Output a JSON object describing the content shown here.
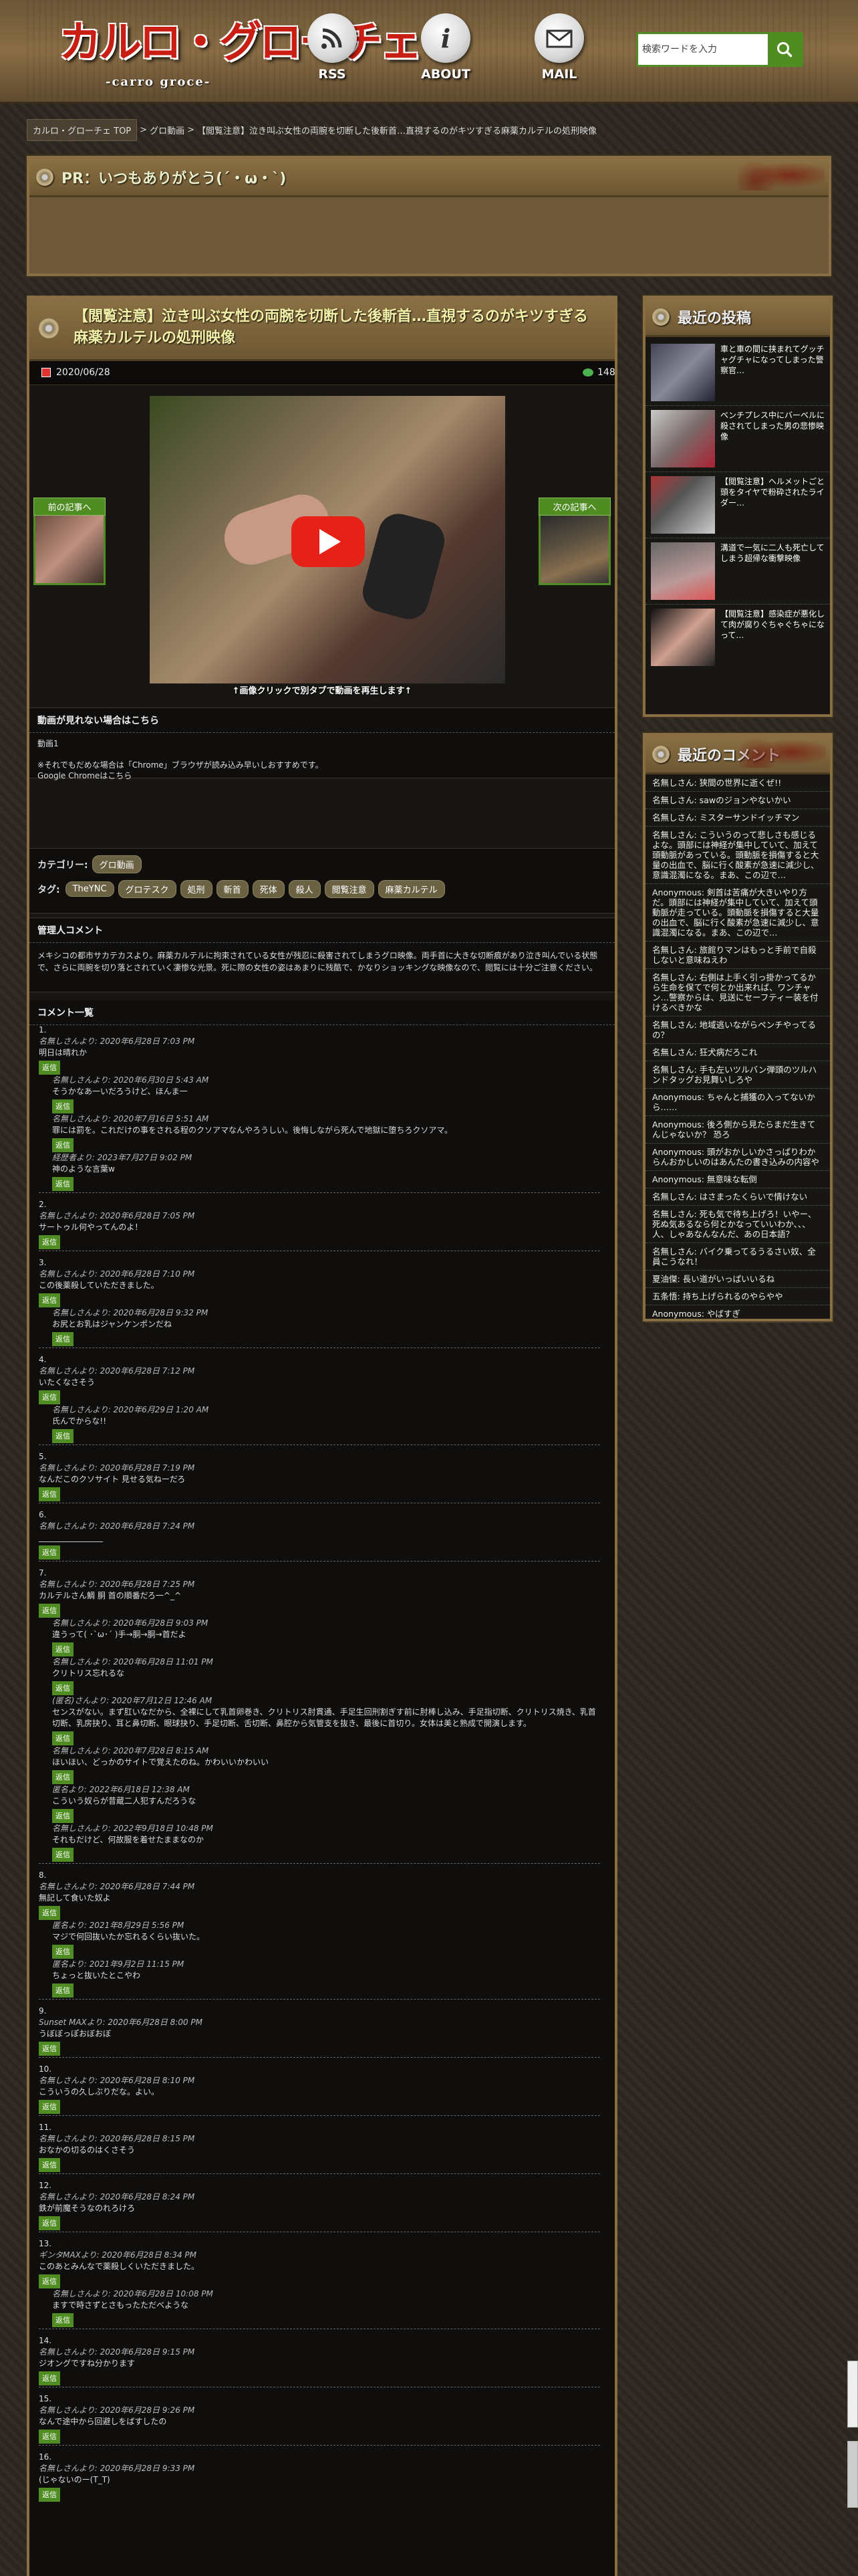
{
  "header": {
    "logo_main": "カルロ・グローチェ",
    "logo_sub": "-carro groce-",
    "nav": [
      {
        "label": "RSS",
        "icon": "rss-icon"
      },
      {
        "label": "ABOUT",
        "icon": "info-icon"
      },
      {
        "label": "MAIL",
        "icon": "mail-icon"
      }
    ],
    "search_placeholder": "検索ワードを入力"
  },
  "breadcrumb": {
    "top": "カルロ・グローチェ TOP",
    "category": "グロ動画",
    "current": "【閲覧注意】泣き叫ぶ女性の両腕を切断した後斬首…直視するのがキツすぎる麻薬カルテルの処刑映像",
    "sep": ">"
  },
  "pr": {
    "title": "PR：いつもありがとう(´・ω・`)"
  },
  "article": {
    "title": "【閲覧注意】泣き叫ぶ女性の両腕を切断した後斬首…直視するのがキツすぎる麻薬カルテルの処刑映像",
    "date": "2020/06/28",
    "comments_count": "148",
    "caption": "↑画像クリックで別タブで動画を再生します↑",
    "prev": "前の記事へ",
    "next": "次の記事へ",
    "alt": {
      "heading": "動画が見れない場合はこちら",
      "link": "動画1",
      "note1": "※それでもだめな場合は「Chrome」ブラウザが読み込み早いしおすすめです。",
      "note2": "Google Chromeはこちら"
    },
    "category_label": "カテゴリー:",
    "category": "グロ動画",
    "tags_label": "タグ:",
    "tags": [
      "TheYNC",
      "グロテスク",
      "処刑",
      "斬首",
      "死体",
      "殺人",
      "閲覧注意",
      "麻薬カルテル"
    ],
    "intro": {
      "heading": "管理人コメント",
      "text": "メキシコの都市サカテカスより。麻薬カルテルに拘束されている女性が残忍に殺害されてしまうグロ映像。両手首に大きな切断痕があり泣き叫んでいる状態で、さらに両腕を切り落とされていく凄惨な光景。死に際の女性の姿はあまりに残酷で、かなりショッキングな映像なので、閲覧には十分ご注意ください。"
    },
    "comments_heading": "コメント一覧"
  },
  "comments": [
    {
      "n": "1.",
      "who": "名無しさんより: 2020年6月28日 7:03 PM",
      "text": "明日は晴れか"
    },
    {
      "who": "名無しさんより: 2020年6月30日 5:43 AM",
      "text": "そうかなあ一いだろうけど、ほんま一"
    },
    {
      "who": "名無しさんより: 2020年7月16日 5:51 AM",
      "text": "罪には罰を。これだけの事をされる程のクソアマなんやろうしい。後悔しながら死んで地獄に堕ちろクソアマ。"
    },
    {
      "who": "経歴者より: 2023年7月27日 9:02 PM",
      "text": "神のような言葉w"
    },
    {
      "n": "2.",
      "who": "名無しさんより: 2020年6月28日 7:05 PM",
      "text": "サートゥル何やってんのよ！"
    },
    {
      "n": "3.",
      "who": "名無しさんより: 2020年6月28日 7:10 PM",
      "text": "この後薬殺していただきました。"
    },
    {
      "who": "名無しさんより: 2020年6月28日 9:32 PM",
      "text": "お尻とお乳はジャンケンポンだね"
    },
    {
      "n": "4.",
      "who": "名無しさんより: 2020年6月28日 7:12 PM",
      "text": "いたくなさそう"
    },
    {
      "who": "名無しさんより: 2020年6月29日 1:20 AM",
      "text": "氏んでからな!!"
    },
    {
      "n": "5.",
      "who": "名無しさんより: 2020年6月28日 7:19 PM",
      "text": "なんだこのクソサイト 見せる気ねーだろ"
    },
    {
      "n": "6.",
      "who": "名無しさんより: 2020年6月28日 7:24 PM",
      "text": "________________"
    },
    {
      "n": "7.",
      "who": "名無しさんより: 2020年6月28日 7:25 PM",
      "text": "カルテルさん鯛 胴 首の順番だろ一^_^"
    },
    {
      "who": "名無しさんより: 2020年6月28日 9:03 PM",
      "text": "違うって( ･`ω･´ )手→胴→胴→首だよ"
    },
    {
      "who": "名無しさんより: 2020年6月28日 11:01 PM",
      "text": "クリトリス忘れるな"
    },
    {
      "who": "(匿名)さんより: 2020年7月12日 12:46 AM",
      "text": "センスがない。まず肛いなだから、全裸にして乳首卵巻き、クリトリス肘貫通、手足生回刑割ぎす前に肘棒し込み、手足指切断、クリトリス焼き、乳首切断、乳房抉り、耳と鼻切断、眼球抉り、手足切断、舌切断、鼻腔から気管支を抜き、最後に首切り。女体は美と熟成で開演します。"
    },
    {
      "who": "名無しさんより: 2020年7月28日 8:15 AM",
      "text": "ほいほい、どっかのサイトで覚えたのね。かわいいかわいい"
    },
    {
      "who": "匿名より: 2022年6月18日 12:38 AM",
      "text": "こういう奴らが昔蔵二人犯すんだろうな"
    },
    {
      "who": "名無しさんより: 2022年9月18日 10:48 PM",
      "text": "それもだけど、何故服を着せたままなのか"
    },
    {
      "n": "8.",
      "who": "名無しさんより: 2020年6月28日 7:44 PM",
      "text": "無記して食いた奴よ"
    },
    {
      "who": "匿名より: 2021年8月29日 5:56 PM",
      "text": "マジで何回抜いたか忘れるくらい抜いた。"
    },
    {
      "who": "匿名より: 2021年9月2日 11:15 PM",
      "text": "ちょっと抜いたとこやわ"
    },
    {
      "n": "9.",
      "who": "Sunset MAXより: 2020年6月28日 8:00 PM",
      "text": "うぼぼっぽおぼおぼ"
    },
    {
      "n": "10.",
      "who": "名無しさんより: 2020年6月28日 8:10 PM",
      "text": "こういうの久しぶりだな。よい。"
    },
    {
      "n": "11.",
      "who": "名無しさんより: 2020年6月28日 8:15 PM",
      "text": "おなかの切るのはくさそう"
    },
    {
      "n": "12.",
      "who": "名無しさんより: 2020年6月28日 8:24 PM",
      "text": "鉄が前魔そうなのれろけろ"
    },
    {
      "n": "13.",
      "who": "ギンタMAXより: 2020年6月28日 8:34 PM",
      "text": "このあとみんなで薬殺しくいただきました。"
    },
    {
      "who": "名無しさんより: 2020年6月28日 10:08 PM",
      "text": "ますで時さずとさもったただべような"
    },
    {
      "n": "14.",
      "who": "名無しさんより: 2020年6月28日 9:15 PM",
      "text": "ジオングですね分かります"
    },
    {
      "n": "15.",
      "who": "名無しさんより: 2020年6月28日 9:26 PM",
      "text": "なんで途中から回避しをばすしたの"
    },
    {
      "n": "16.",
      "who": "名無しさんより: 2020年6月28日 9:33 PM",
      "text": "(じゃないのー(T_T)"
    }
  ],
  "reply_label": "返信",
  "sidebar": {
    "recent_title": "最近の投稿",
    "posts": [
      "車と車の間に挟まれてグッチャグチャになってしまった警察官…",
      "ベンチプレス中にバーベルに殺されてしまった男の悲惨映像",
      "【閲覧注意】ヘルメットごと頭をタイヤで粉砕されたライダー…",
      "溝道で一気に二人も死亡してしまう超帰な衝撃映像",
      "【閲覧注意】感染症が悪化して肉が腐りぐちゃぐちゃになって…"
    ],
    "comments_title": "最近のコメント",
    "recent_comments": [
      "名無しさん: 狭間の世界に逝くぜ!!",
      "名無しさん: sawのジョンやないかい",
      "名無しさん: ミスターサンドイッチマン",
      "名無しさん: こういうのって悲しさも感じるよな。頭部には神経が集中していて、加えて頭動脈があっている。頭動脈を損傷すると大量の出血で、脳に行く酸素が急速に減少し、意識混濁になる。まあ、この辺で…",
      "Anonymous: 剣首は苦痛が大きいやり方だ。頭部には神経が集中していて、加えて頭動脈が走っている。頭動脈を損傷すると大量の出血で、脳に行く酸素が急速に減少し、意識混濁になる。まあ、この辺で…",
      "名無しさん: 旅館りマンはもっと手前で自殺しないと意味ねえわ",
      "名無しさん: 右側は上手く引っ掛かってるから生命を保てで何とか出来れば、ワンチャン…警察からは、見送にセーフティー装を付けるべきかな",
      "名無しさん: 地域逃いながらペンチやってるの？",
      "名無しさん: 狂犬病だろこれ",
      "名無しさん: 手も左いツルバン弾頭のツルハンドタッグお見舞いしろや",
      "Anonymous: ちゃんと捕獲の入ってないから……",
      "Anonymous: 後ろ側から見たらまだ生きてんじゃないか？ 恐ろ",
      "Anonymous: 頭がおかしいかさっぱりわからんおかしいのはあんたの書き込みの内容や",
      "Anonymous: 無意味な転倒",
      "名無しさん: はさまったくらいで情けない",
      "名無しさん: 死も気で待ち上げろ！いやー、死ぬ気あるなら何とかなっていいわか、、、人、しゃあなんなんだ、あの日本語？",
      "名無しさん: バイク乗ってるうるさい奴、全員こうなれ！",
      "夏油傑: 長い道がいっぱいいるね",
      "五条悟: 持ち上げられるのやらやや",
      "Anonymous: やばすぎ"
    ]
  }
}
